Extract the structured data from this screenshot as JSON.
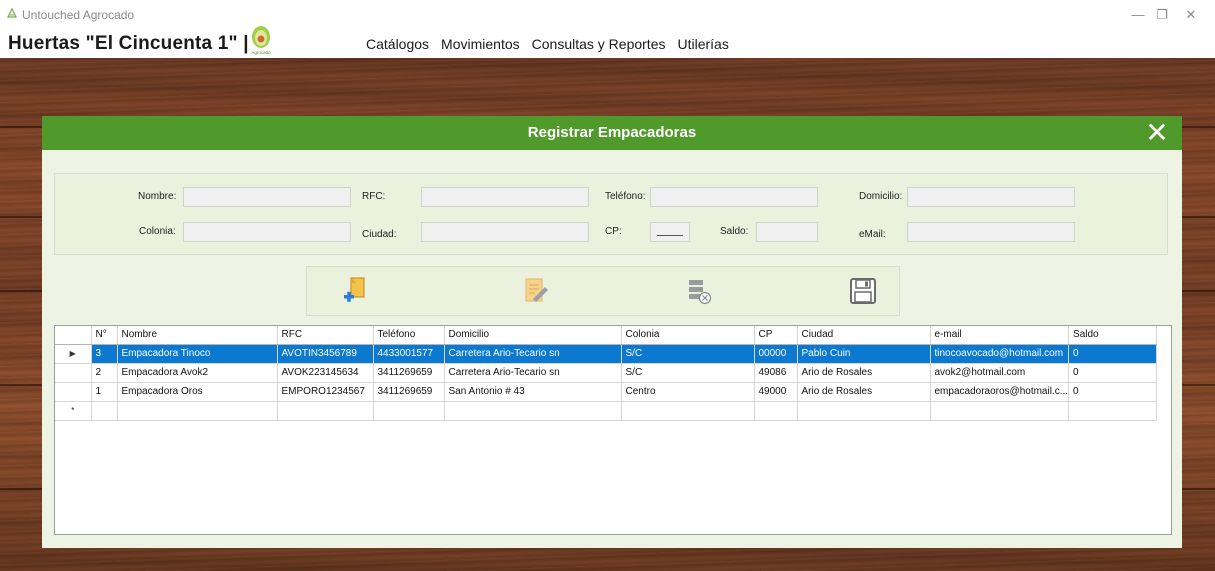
{
  "window": {
    "title": "Untouched Agrocado",
    "min_icon": "minimize-icon",
    "max_icon": "maximize-icon",
    "close_icon": "close-icon"
  },
  "menubar": {
    "brand": "Huertas \"El Cincuenta 1\" |",
    "logo_text": "Agrocado",
    "items": [
      "Catálogos",
      "Movimientos",
      "Consultas y Reportes",
      "Utilerías"
    ]
  },
  "dialog": {
    "title": "Registrar Empacadoras",
    "close_icon": "close-x-icon",
    "header_color": "#4f9a2a",
    "form": {
      "nombre": {
        "label": "Nombre:",
        "value": ""
      },
      "rfc": {
        "label": "RFC:",
        "value": ""
      },
      "telefono": {
        "label": "Teléfono:",
        "value": ""
      },
      "domicilio": {
        "label": "Domicilio:",
        "value": ""
      },
      "colonia": {
        "label": "Colonia:",
        "value": ""
      },
      "ciudad": {
        "label": "Ciudad:",
        "value": ""
      },
      "cp": {
        "label": "CP:",
        "value": ""
      },
      "saldo": {
        "label": "Saldo:",
        "value": ""
      },
      "email": {
        "label": "eMail:",
        "value": ""
      }
    },
    "toolbar": {
      "new_icon": "new-document-icon",
      "edit_icon": "edit-document-icon",
      "delete_icon": "delete-record-icon",
      "save_icon": "save-floppy-icon"
    },
    "table": {
      "columns": [
        "N°",
        "Nombre",
        "RFC",
        "Teléfono",
        "Domicilio",
        "Colonia",
        "CP",
        "Ciudad",
        "e-mail",
        "Saldo"
      ],
      "rows": [
        [
          "3",
          "Empacadora Tinoco",
          "AVOTIN3456789",
          "4433001577",
          "Carretera Ario-Tecario sn",
          "S/C",
          "00000",
          "Pablo Cuin",
          "tinocoavocado@hotmail.com",
          "0"
        ],
        [
          "2",
          "Empacadora Avok2",
          "AVOK223145634",
          "3411269659",
          "Carretera Ario-Tecario sn",
          "S/C",
          "49086",
          "Ario de Rosales",
          "avok2@hotmail.com",
          "0"
        ],
        [
          "1",
          "Empacadora Oros",
          "EMPORO1234567",
          "3411269659",
          "San Antonio # 43",
          "Centro",
          "49000",
          "Ario de Rosales",
          "empacadoraoros@hotmail.c...",
          "0"
        ]
      ],
      "selected_row_color": "#0b79d0",
      "current_row_marker": "▶",
      "new_row_marker": "*"
    }
  }
}
